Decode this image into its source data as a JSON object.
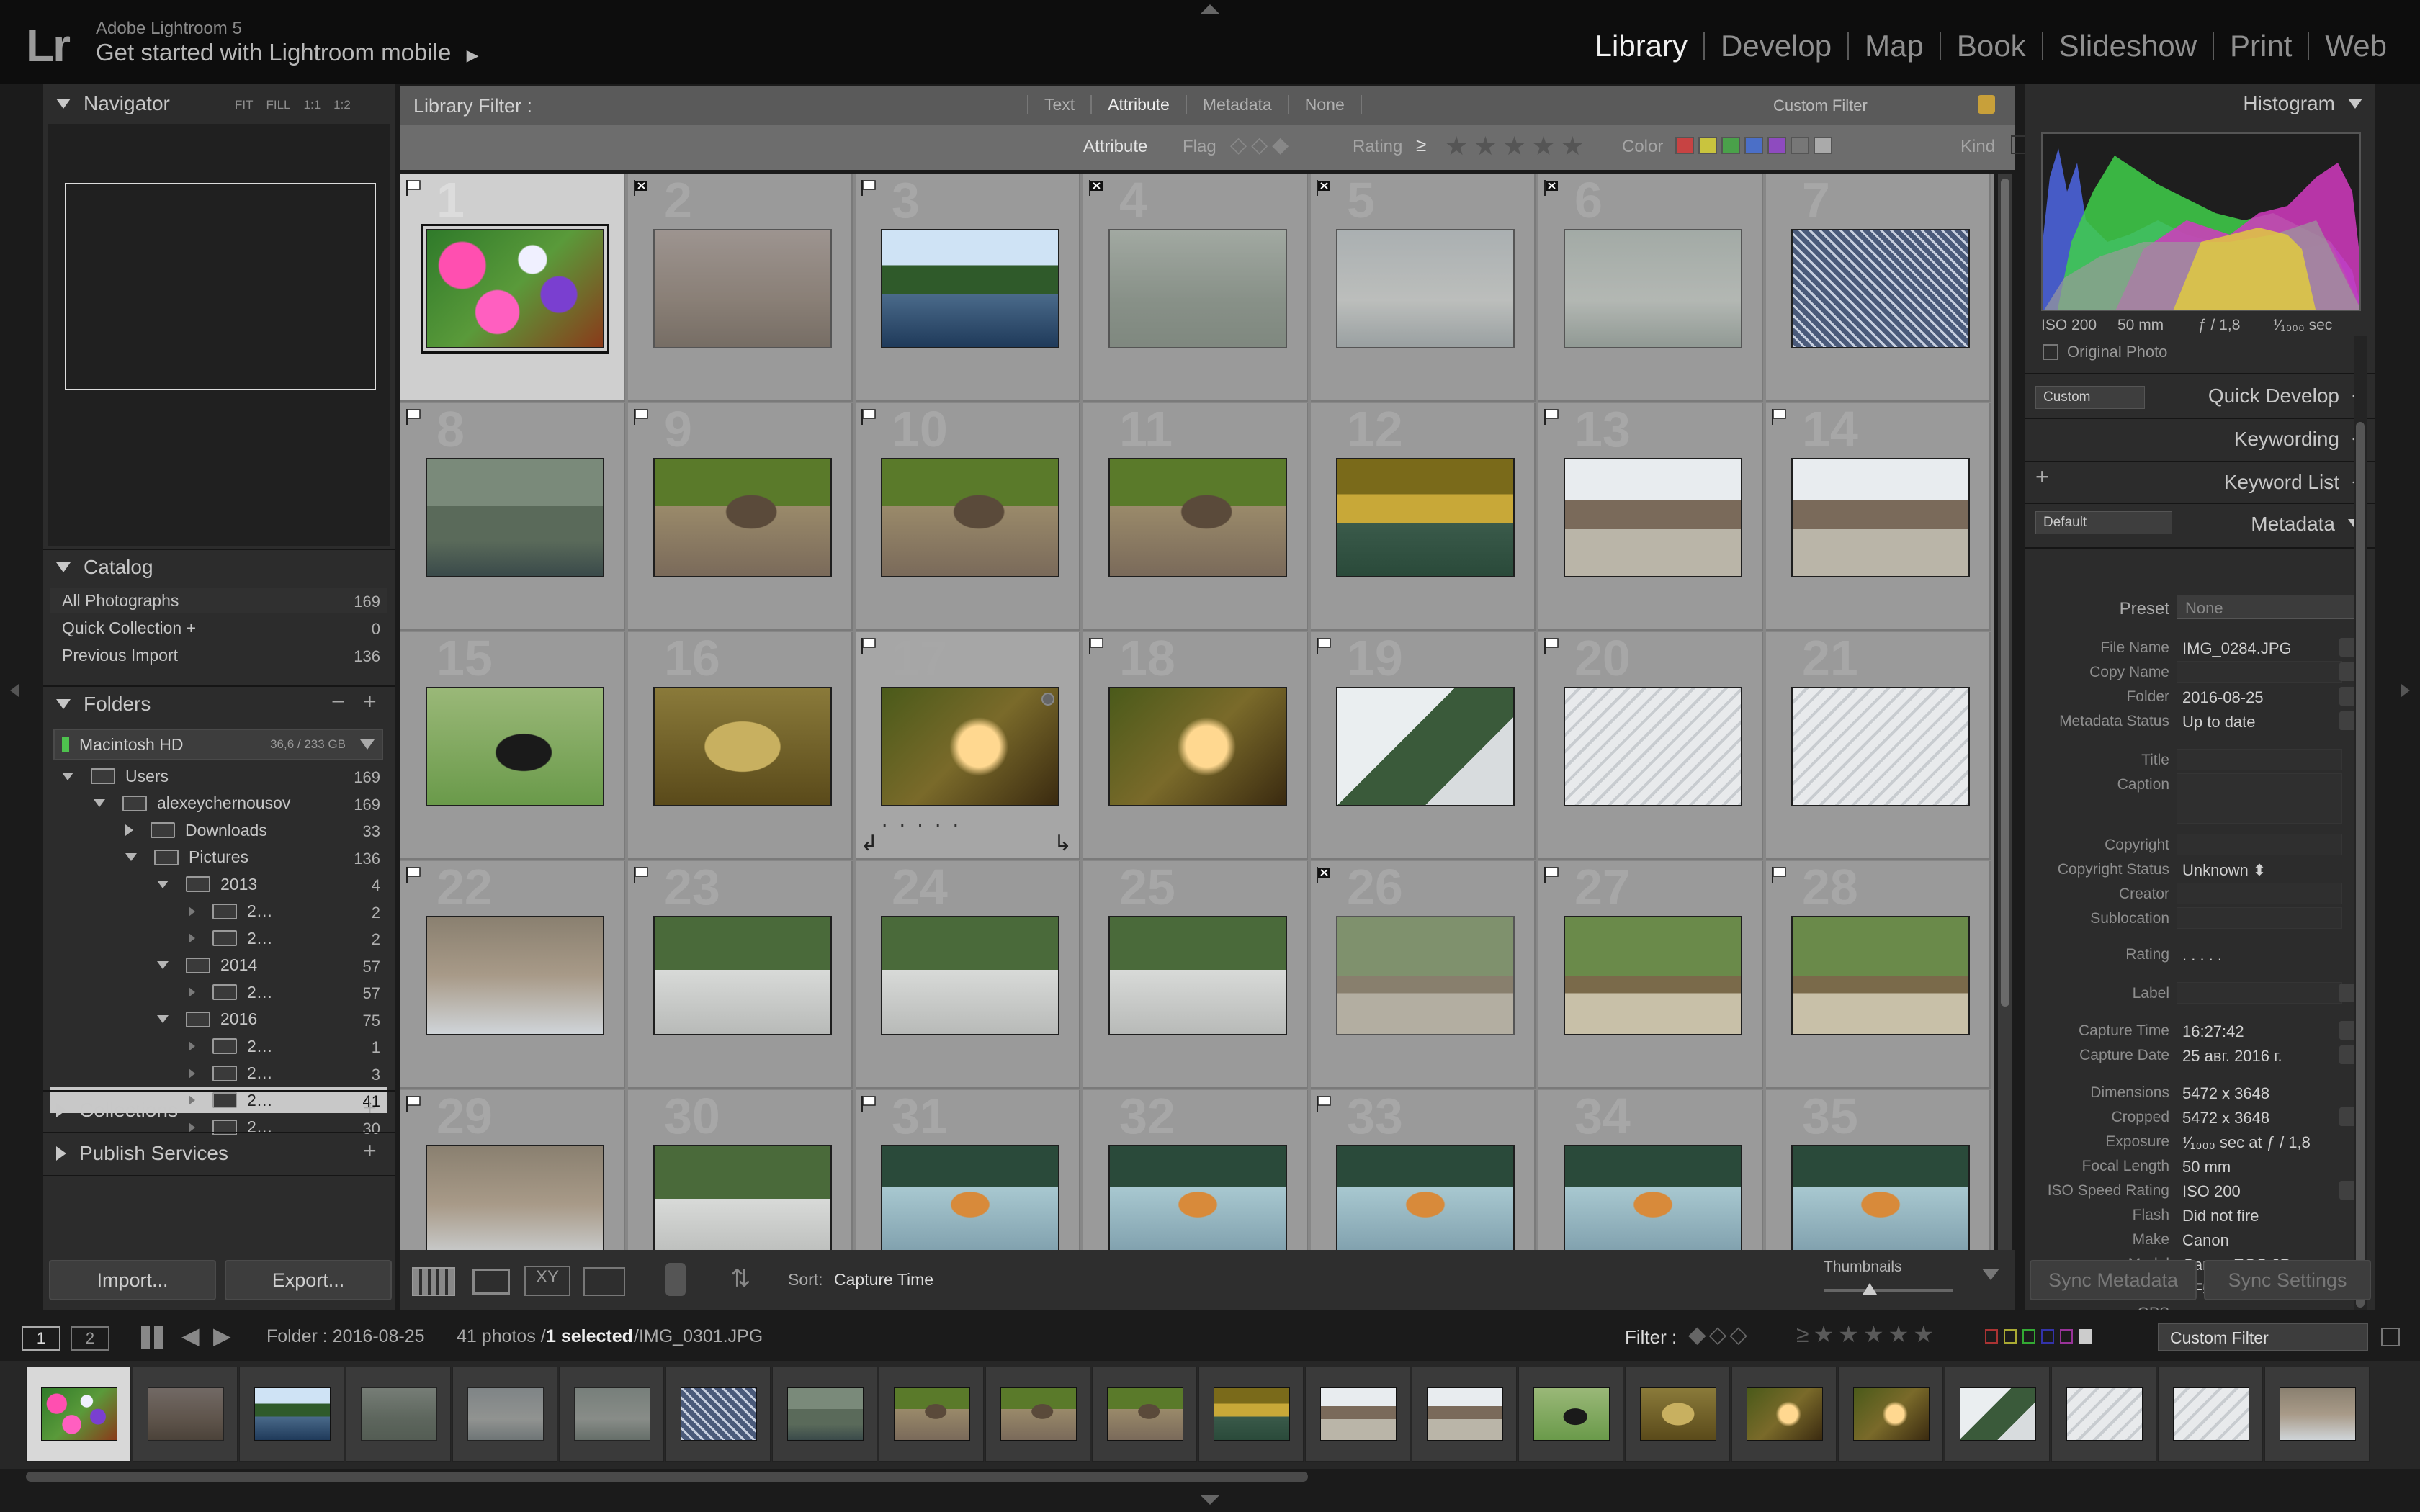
{
  "app": {
    "logo": "Lr",
    "version": "Adobe Lightroom 5",
    "mobile_promo": "Get started with Lightroom mobile"
  },
  "modules": [
    {
      "label": "Library",
      "active": true
    },
    {
      "label": "Develop"
    },
    {
      "label": "Map"
    },
    {
      "label": "Book"
    },
    {
      "label": "Slideshow"
    },
    {
      "label": "Print"
    },
    {
      "label": "Web"
    }
  ],
  "navigator": {
    "title": "Navigator",
    "zoom_options": [
      "FIT",
      "FILL",
      "1:1",
      "1:2"
    ]
  },
  "catalog": {
    "title": "Catalog",
    "items": [
      {
        "label": "All Photographs",
        "count": "169"
      },
      {
        "label": "Quick Collection +",
        "count": "0"
      },
      {
        "label": "Previous Import",
        "count": "136"
      }
    ]
  },
  "folders": {
    "title": "Folders",
    "minus": "−",
    "plus": "+",
    "volume": {
      "name": "Macintosh HD",
      "usage": "36,6 / 233 GB"
    },
    "tree": [
      {
        "label": "Users",
        "count": "169"
      },
      {
        "label": "alexeychernousov",
        "count": "169"
      },
      {
        "label": "Downloads",
        "count": "33"
      },
      {
        "label": "Pictures",
        "count": "136"
      },
      {
        "label": "2013",
        "count": "4"
      },
      {
        "label": "2…",
        "count": "2"
      },
      {
        "label": "2…",
        "count": "2"
      },
      {
        "label": "2014",
        "count": "57"
      },
      {
        "label": "2…",
        "count": "57"
      },
      {
        "label": "2016",
        "count": "75"
      },
      {
        "label": "2…",
        "count": "1"
      },
      {
        "label": "2…",
        "count": "3"
      },
      {
        "label": "2…",
        "count": "41"
      },
      {
        "label": "2…",
        "count": "30"
      }
    ]
  },
  "collections": {
    "title": "Collections",
    "plus": "+"
  },
  "publish": {
    "title": "Publish Services",
    "plus": "+"
  },
  "left_buttons": {
    "import": "Import...",
    "export": "Export..."
  },
  "filter_bar": {
    "title": "Library Filter :",
    "tabs": [
      "Text",
      "Attribute",
      "Metadata",
      "None"
    ],
    "preset": "Custom Filter",
    "attribute_label": "Attribute",
    "flag_label": "Flag",
    "rating_label": "Rating",
    "rating_op": "≥",
    "color_label": "Color",
    "kind_label": "Kind",
    "color_swatches": [
      "#c74343",
      "#c9c43e",
      "#4aa14a",
      "#4b6fc7",
      "#8e4bbf",
      "#777777",
      "#aaaaaa"
    ]
  },
  "grid": {
    "cells": [
      {
        "num": "1",
        "flag": "pick",
        "sel": true,
        "img": "flowers"
      },
      {
        "num": "2",
        "flag": "reject",
        "img": "people"
      },
      {
        "num": "3",
        "flag": "pick",
        "img": "lake"
      },
      {
        "num": "4",
        "flag": "reject",
        "img": "fog"
      },
      {
        "num": "5",
        "flag": "reject",
        "img": "whitetiger"
      },
      {
        "num": "6",
        "flag": "reject",
        "img": "whitetiger2"
      },
      {
        "num": "7",
        "flag": "none",
        "img": "cage"
      },
      {
        "num": "8",
        "flag": "pick",
        "img": "pond"
      },
      {
        "num": "9",
        "flag": "pick",
        "img": "raccoon"
      },
      {
        "num": "10",
        "flag": "pick",
        "img": "raccoon"
      },
      {
        "num": "11",
        "flag": "none",
        "img": "raccoon"
      },
      {
        "num": "12",
        "flag": "none",
        "img": "seal"
      },
      {
        "num": "13",
        "flag": "pick",
        "img": "crowd"
      },
      {
        "num": "14",
        "flag": "pick",
        "img": "crowd"
      },
      {
        "num": "15",
        "flag": "none",
        "img": "yak"
      },
      {
        "num": "16",
        "flag": "none",
        "img": "sandbox"
      },
      {
        "num": "17",
        "flag": "pick",
        "img": "ferret",
        "hover": true
      },
      {
        "num": "18",
        "flag": "pick",
        "img": "ferret"
      },
      {
        "num": "19",
        "flag": "pick",
        "img": "snowtree"
      },
      {
        "num": "20",
        "flag": "pick",
        "img": "snowstairs"
      },
      {
        "num": "21",
        "flag": "none",
        "img": "snowstairs"
      },
      {
        "num": "22",
        "flag": "pick",
        "img": "rocks"
      },
      {
        "num": "23",
        "flag": "pick",
        "img": "lynx"
      },
      {
        "num": "24",
        "flag": "none",
        "img": "lynx"
      },
      {
        "num": "25",
        "flag": "none",
        "img": "lynx"
      },
      {
        "num": "26",
        "flag": "reject",
        "img": "logs"
      },
      {
        "num": "27",
        "flag": "pick",
        "img": "logs"
      },
      {
        "num": "28",
        "flag": "pick",
        "img": "logs"
      },
      {
        "num": "29",
        "flag": "pick",
        "img": "rocks"
      },
      {
        "num": "30",
        "flag": "none",
        "img": "lynx"
      },
      {
        "num": "31",
        "flag": "pick",
        "img": "tiger"
      },
      {
        "num": "32",
        "flag": "none",
        "img": "tiger"
      },
      {
        "num": "33",
        "flag": "pick",
        "img": "tiger"
      },
      {
        "num": "34",
        "flag": "none",
        "img": "tiger"
      },
      {
        "num": "35",
        "flag": "none",
        "img": "tiger"
      }
    ]
  },
  "toolbar": {
    "sort_label": "Sort:",
    "sort_value": "Capture Time",
    "thumbnails_label": "Thumbnails",
    "rating_dots": ". . . . ."
  },
  "histogram": {
    "title": "Histogram",
    "iso": "ISO 200",
    "focal": "50 mm",
    "aperture": "ƒ / 1,8",
    "shutter": "¹⁄₁₀₀₀ sec",
    "original_photo": "Original Photo"
  },
  "right_panels": {
    "quick_develop": "Quick Develop",
    "quick_develop_preset": "Custom",
    "keywording": "Keywording",
    "keyword_list": "Keyword List",
    "keyword_plus": "+",
    "metadata": "Metadata",
    "metadata_preset_sel": "Default"
  },
  "metadata": {
    "preset_label": "Preset",
    "preset_value": "None",
    "rows": [
      {
        "label": "File Name",
        "value": "IMG_0284.JPG"
      },
      {
        "label": "Copy Name",
        "value": ""
      },
      {
        "label": "Folder",
        "value": "2016-08-25"
      },
      {
        "label": "Metadata Status",
        "value": "Up to date"
      }
    ],
    "iptc": [
      {
        "label": "Title",
        "value": ""
      },
      {
        "label": "Caption",
        "value": ""
      },
      {
        "label": "Copyright",
        "value": ""
      },
      {
        "label": "Copyright Status",
        "value": "Unknown ⬍"
      },
      {
        "label": "Creator",
        "value": ""
      },
      {
        "label": "Sublocation",
        "value": ""
      }
    ],
    "rating_label": "Rating",
    "rating_value": ". . . . .",
    "label_label": "Label",
    "exif": [
      {
        "label": "Capture Time",
        "value": "16:27:42"
      },
      {
        "label": "Capture Date",
        "value": "25 авг. 2016 г."
      },
      {
        "label": "Dimensions",
        "value": "5472 x 3648"
      },
      {
        "label": "Cropped",
        "value": "5472 x 3648"
      },
      {
        "label": "Exposure",
        "value": "¹⁄₁₀₀₀ sec at ƒ / 1,8"
      },
      {
        "label": "Focal Length",
        "value": "50 mm"
      },
      {
        "label": "ISO Speed Rating",
        "value": "ISO 200"
      },
      {
        "label": "Flash",
        "value": "Did not fire"
      },
      {
        "label": "Make",
        "value": "Canon"
      },
      {
        "label": "Model",
        "value": "Canon EOS 6D"
      },
      {
        "label": "Lens",
        "value": "EF50mm f/1.8 STM"
      },
      {
        "label": "GPS",
        "value": ""
      }
    ]
  },
  "right_buttons": {
    "sync_metadata": "Sync Metadata",
    "sync_settings": "Sync Settings"
  },
  "filmstrip_bar": {
    "screen1": "1",
    "screen2": "2",
    "folder": "Folder : 2016-08-25",
    "count_prefix": "41 photos /",
    "selected": "1 selected",
    "file": "/IMG_0301.JPG",
    "filter_label": "Filter :",
    "filter_preset": "Custom Filter"
  },
  "filmstrip": {
    "thumbs": [
      "flowers",
      "people",
      "lake",
      "fog",
      "whitetiger",
      "whitetiger2",
      "cage",
      "pond",
      "raccoon",
      "raccoon",
      "raccoon",
      "seal",
      "crowd",
      "crowd",
      "yak",
      "sandbox",
      "ferret",
      "ferret",
      "snowtree",
      "snowstairs",
      "snowstairs",
      "rocks"
    ]
  }
}
